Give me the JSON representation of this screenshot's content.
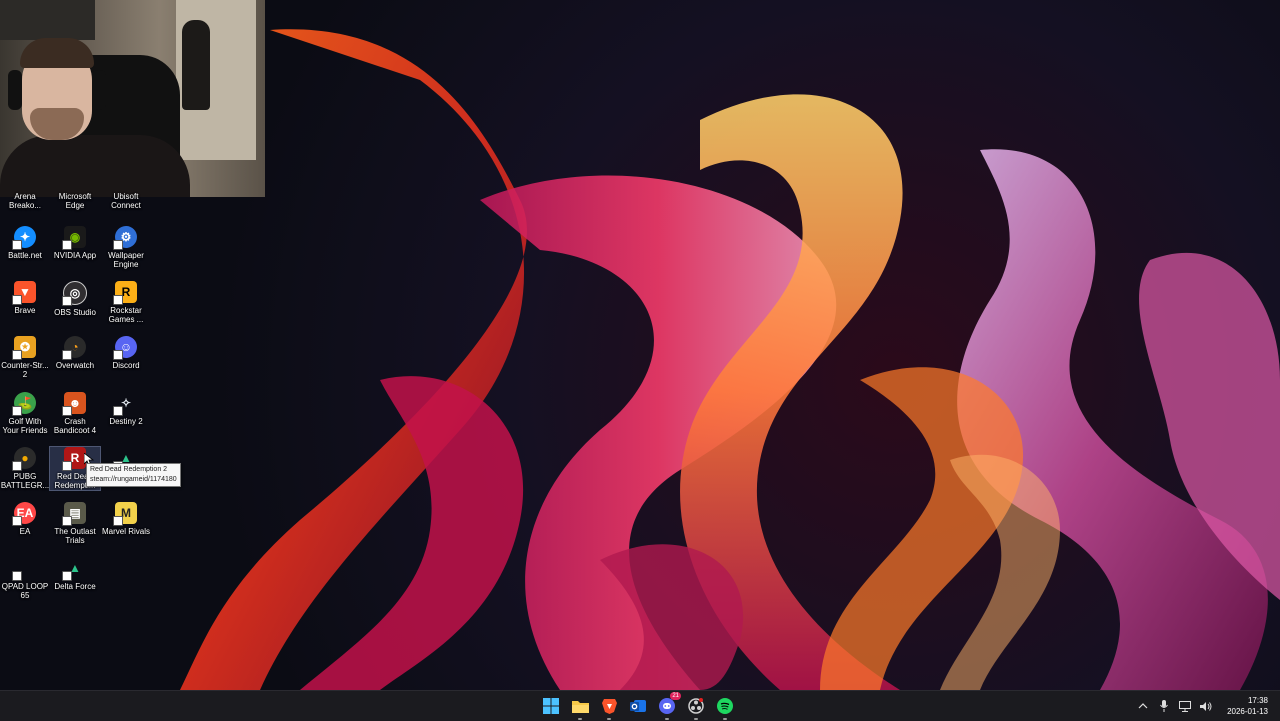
{
  "desktop": {
    "icons": [
      {
        "label": "Arena\nBreako...",
        "icon": "arena-breakout-icon",
        "color": "#8a4a2a"
      },
      {
        "label": "Microsoft\nEdge",
        "icon": "edge-icon",
        "color": "#1f8ad6"
      },
      {
        "label": "Ubisoft\nConnect",
        "icon": "ubisoft-icon",
        "color": "#2a63c8"
      },
      {
        "label": "Battle.net",
        "icon": "battlenet-icon",
        "color": "#148eff"
      },
      {
        "label": "NVIDIA App",
        "icon": "nvidia-icon",
        "color": "#76b900"
      },
      {
        "label": "Wallpaper\nEngine",
        "icon": "wallpaper-engine-icon",
        "color": "#2f6fd6"
      },
      {
        "label": "Brave",
        "icon": "brave-icon",
        "color": "#fb542b"
      },
      {
        "label": "OBS Studio",
        "icon": "obs-icon",
        "color": "#302e31"
      },
      {
        "label": "Rockstar\nGames ...",
        "icon": "rockstar-icon",
        "color": "#fcaf17"
      },
      {
        "label": "Counter-Str...\n2",
        "icon": "counter-strike-icon",
        "color": "#e9a221"
      },
      {
        "label": "Overwatch",
        "icon": "overwatch-icon",
        "color": "#f99e1a"
      },
      {
        "label": "Discord",
        "icon": "discord-icon",
        "color": "#5865f2"
      },
      {
        "label": "Golf With\nYour Friends",
        "icon": "golf-icon",
        "color": "#3aa24a"
      },
      {
        "label": "Crash\nBandicoot 4",
        "icon": "crash-icon",
        "color": "#d9541e"
      },
      {
        "label": "Destiny 2",
        "icon": "destiny-icon",
        "color": "#cfd6de"
      },
      {
        "label": "PUBG\nBATTLEGR...",
        "icon": "pubg-icon",
        "color": "#f2a900"
      },
      {
        "label": "Red Dead\nRedempti...",
        "icon": "red-dead-icon",
        "color": "#b01616"
      },
      {
        "label": "Delta Force",
        "icon": "delta-force-icon",
        "color": "#2cc38b"
      },
      {
        "label": "EA",
        "icon": "ea-icon",
        "color": "#ff4747"
      },
      {
        "label": "The Outlast\nTrials",
        "icon": "outlast-icon",
        "color": "#5a5a4a"
      },
      {
        "label": "Marvel Rivals",
        "icon": "marvel-rivals-icon",
        "color": "#f2d14b"
      },
      {
        "label": "QPAD LOOP\n65",
        "icon": "qpad-icon",
        "color": "#222222"
      },
      {
        "label": "Delta Force",
        "icon": "delta-force-icon",
        "color": "#2cc38b"
      }
    ],
    "tooltip": {
      "line1": "Red Dead Redemption 2",
      "line2": "steam://rungameid/1174180"
    }
  },
  "taskbar": {
    "apps": [
      {
        "name": "start",
        "icon": "windows-start-icon",
        "color": "#4cc2ff"
      },
      {
        "name": "file-explorer",
        "icon": "folder-icon",
        "color": "#f7c948"
      },
      {
        "name": "brave",
        "icon": "brave-icon",
        "color": "#fb542b"
      },
      {
        "name": "outlook",
        "icon": "outlook-icon",
        "color": "#1a73e8"
      },
      {
        "name": "discord",
        "icon": "discord-icon",
        "color": "#5865f2",
        "badge": "21"
      },
      {
        "name": "obs",
        "icon": "obs-icon",
        "color": "#d0d0d0"
      },
      {
        "name": "spotify",
        "icon": "spotify-icon",
        "color": "#1ed760"
      }
    ],
    "clock": {
      "time": "17:38",
      "date": "2026-01-13"
    }
  }
}
